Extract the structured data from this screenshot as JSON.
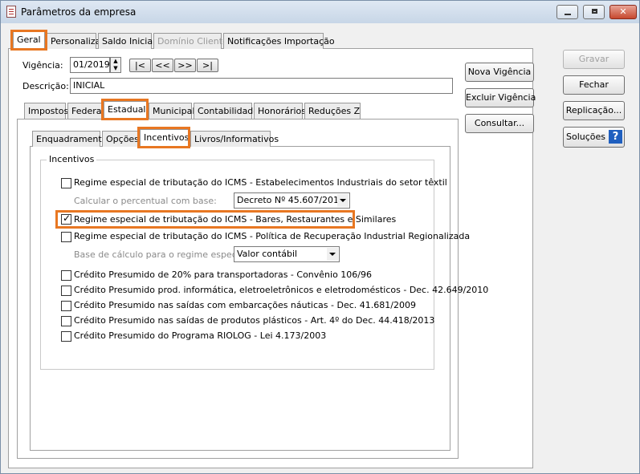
{
  "window": {
    "title": "Parâmetros da empresa"
  },
  "main_tabs": [
    "Geral",
    "Personaliza",
    "Saldo Inicial",
    "Domínio Cliente",
    "Notificações Importação"
  ],
  "form": {
    "vigencia_label": "Vigência:",
    "vigencia_value": "01/2019",
    "nav": [
      "|<",
      "<<",
      ">>",
      ">|"
    ],
    "descricao_label": "Descrição:",
    "descricao_value": "INICIAL"
  },
  "sub_tabs": [
    "Impostos",
    "Federal",
    "Estadual",
    "Municipal",
    "Contabilidade",
    "Honorários",
    "Reduções Z"
  ],
  "inner_tabs": [
    "Enquadramento",
    "Opções",
    "Incentivos",
    "Livros/Informativos"
  ],
  "middle_buttons": [
    "Nova Vigência",
    "Excluir Vigência",
    "Consultar..."
  ],
  "right_buttons": [
    "Gravar",
    "Fechar",
    "Replicação...",
    "Soluções"
  ],
  "help_glyph": "?",
  "incentivos": {
    "group_title": "Incentivos",
    "items": [
      {
        "label": "Regime especial de tributação do ICMS - Estabelecimentos Industriais do setor têxtil",
        "checked": false
      },
      {
        "label": "Regime especial de tributação do ICMS - Bares, Restaurantes e Similares",
        "checked": true
      },
      {
        "label": "Regime especial de tributação do ICMS - Política de Recuperação Industrial Regionalizada",
        "checked": false
      },
      {
        "label": "Crédito Presumido de 20% para transportadoras - Convênio 106/96",
        "checked": false
      },
      {
        "label": "Crédito Presumido prod. informática, eletroeletrônicos e eletrodomésticos - Dec. 42.649/2010",
        "checked": false
      },
      {
        "label": "Crédito Presumido nas saídas com embarcações náuticas - Dec. 41.681/2009",
        "checked": false
      },
      {
        "label": "Crédito Presumido nas saídas de produtos plásticos - Art. 4º do Dec. 44.418/2013",
        "checked": false
      },
      {
        "label": "Crédito Presumido do Programa RIOLOG - Lei 4.173/2003",
        "checked": false
      }
    ],
    "calc_label": "Calcular o percentual com base:",
    "calc_value": "Decreto Nº 45.607/2016",
    "base_label": "Base de cálculo para o regime especial:",
    "base_value": "Valor contábil"
  },
  "colors": {
    "highlight": "#e87722",
    "help_icon": "#1f5fbf"
  }
}
